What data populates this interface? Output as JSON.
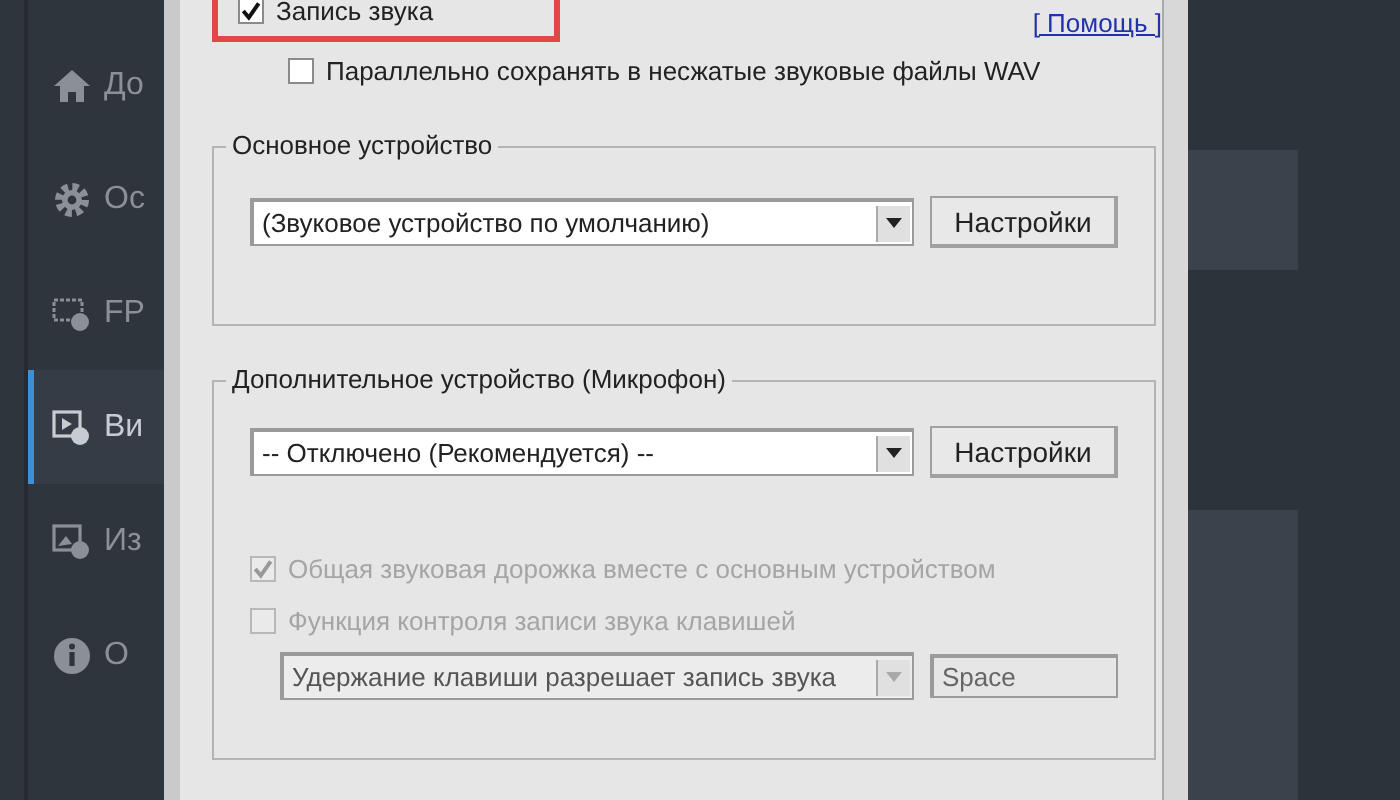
{
  "sidebar": {
    "items": [
      {
        "kind": "home",
        "label": "До",
        "selected": false
      },
      {
        "kind": "gear",
        "label": "Ос",
        "selected": false
      },
      {
        "kind": "fps",
        "label": "FP",
        "selected": false
      },
      {
        "kind": "video",
        "label": "Ви",
        "selected": true
      },
      {
        "kind": "image",
        "label": "Из",
        "selected": false
      },
      {
        "kind": "info",
        "label": "О",
        "selected": false
      }
    ]
  },
  "dialog": {
    "record_sound": {
      "label": "Запись звука",
      "checked": true,
      "highlighted": true
    },
    "help_link": "[ Помощь ]",
    "save_wav": {
      "label": "Параллельно сохранять в несжатые звуковые файлы WAV",
      "checked": false
    },
    "main_device": {
      "title": "Основное устройство",
      "select": {
        "value": "(Звуковое устройство по умолчанию)",
        "disabled": false
      },
      "button": "Настройки"
    },
    "extra_device": {
      "title": "Дополнительное устройство (Микрофон)",
      "select": {
        "value": "-- Отключено (Рекомендуется) --",
        "disabled": false
      },
      "button": "Настройки",
      "options": [
        {
          "label": "Общая звуковая дорожка вместе с основным устройством",
          "checked": true,
          "disabled": true
        },
        {
          "label": "Функция контроля записи звука клавишей",
          "checked": false,
          "disabled": true
        }
      ],
      "hotkey_mode": {
        "value": "Удержание клавиши разрешает запись звука",
        "disabled": true
      },
      "hotkey": {
        "value": "Space",
        "disabled": true
      }
    }
  }
}
